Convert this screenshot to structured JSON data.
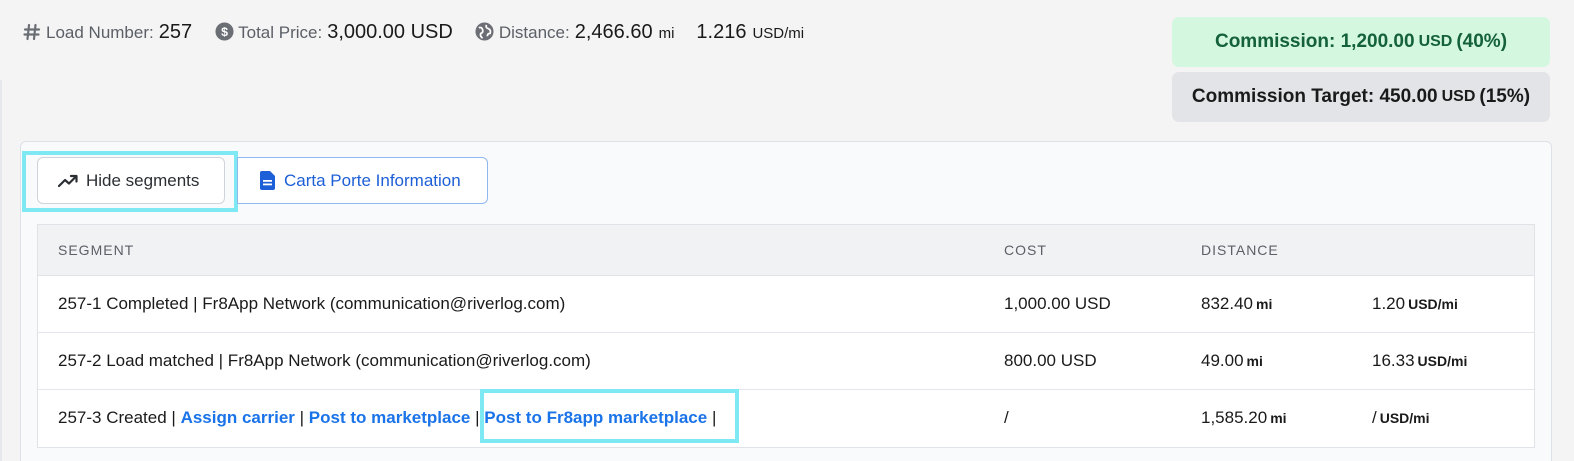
{
  "summary": {
    "load_label": "Load Number:",
    "load_value": "257",
    "price_label": "Total Price:",
    "price_value": "3,000.00 USD",
    "distance_label": "Distance:",
    "distance_value": "2,466.60",
    "distance_unit": "mi",
    "rate_value": "1.216",
    "rate_unit": "USD/mi",
    "icons": [
      "hash-icon",
      "dollar-circle-icon",
      "globe-icon"
    ]
  },
  "commission": {
    "label": "Commission: 1,200.00",
    "unit": "USD",
    "pct": "(40%)",
    "color": "#d4f7e0"
  },
  "target": {
    "label": "Commission Target: 450.00",
    "unit": "USD",
    "pct": "(15%)"
  },
  "buttons": {
    "hide_segments": "Hide segments",
    "carta_porte": "Carta Porte Information"
  },
  "table": {
    "headers": [
      "SEGMENT",
      "COST",
      "DISTANCE"
    ],
    "rows": [
      {
        "segment": "257-1 Completed | Fr8App Network (communication@riverlog.com)",
        "cost": "1,000.00 USD",
        "distance": "832.40",
        "distance_unit": "mi",
        "rate": "1.20",
        "rate_unit": "USD/mi"
      },
      {
        "segment": "257-2 Load matched | Fr8App Network (communication@riverlog.com)",
        "cost": "800.00 USD",
        "distance": "49.00",
        "distance_unit": "mi",
        "rate": "16.33",
        "rate_unit": "USD/mi"
      },
      {
        "segment_prefix": "257-3 Created |",
        "assign_carrier": "Assign carrier",
        "sep1": "|",
        "post_marketplace": "Post to marketplace",
        "sep2": "|",
        "post_fr8app": "Post to Fr8app marketplace",
        "sep3": "|",
        "cost": "/",
        "distance": "1,585.20",
        "distance_unit": "mi",
        "rate": "/",
        "rate_unit": "USD/mi"
      }
    ]
  },
  "colors": {
    "link": "#1a73e8",
    "highlight": "#7ee8f3"
  }
}
